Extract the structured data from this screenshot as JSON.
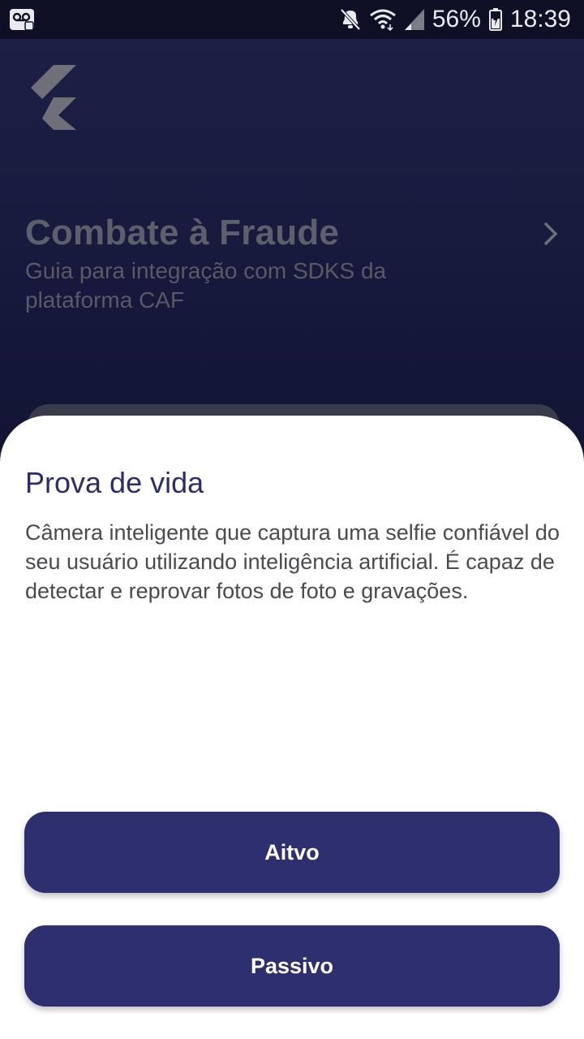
{
  "status_bar": {
    "battery": "56%",
    "time": "18:39",
    "icons": [
      "voicemail-icon",
      "mute-icon",
      "wifi-icon",
      "signal-icon",
      "battery-icon"
    ]
  },
  "header": {
    "title": "Combate à Fraude",
    "subtitle": "Guia para integração com SDKS da plataforma CAF",
    "logo": "flutter-logo-icon",
    "chevron": "chevron-right-icon"
  },
  "sheet": {
    "title": "Prova de vida",
    "description": "Câmera inteligente que captura uma selfie confiável do seu usuário utilizando inteligência artificial. É capaz de detectar e reprovar fotos de foto e gravações.",
    "buttons": {
      "ativo": "Aitvo",
      "passivo": "Passivo"
    }
  },
  "colors": {
    "button": "#2e2f6e",
    "sheet_title": "#2d2d6b",
    "background": "#151631"
  }
}
